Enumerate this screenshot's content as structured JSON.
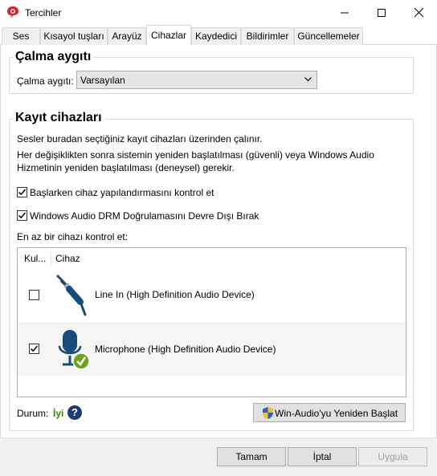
{
  "window": {
    "title": "Tercihler",
    "icons": {
      "app": "red-speech-bubble-icon",
      "minimize": "minimize-icon",
      "maximize": "maximize-icon",
      "close": "close-icon"
    }
  },
  "tabs": [
    {
      "label": "Ses",
      "active": false
    },
    {
      "label": "Kısayol tuşları",
      "active": false
    },
    {
      "label": "Arayüz",
      "active": false
    },
    {
      "label": "Cihazlar",
      "active": true
    },
    {
      "label": "Kaydedici",
      "active": false
    },
    {
      "label": "Bildirimler",
      "active": false
    },
    {
      "label": "Güncellemeler",
      "active": false
    }
  ],
  "playback": {
    "group_title": "Çalma aygıtı",
    "label": "Çalma aygıtı:",
    "selected": "Varsayılan"
  },
  "recording": {
    "group_title": "Kayıt cihazları",
    "info1": "Sesler buradan seçtiğiniz kayıt cihazları üzerinden çalınır.",
    "info2_line1": "Her değişiklikten sonra sistemin yeniden başlatılması (güvenli) veya Windows Audio",
    "info2_line2": "Hizmetinin yeniden başlatılması (deneysel) gerekir.",
    "check_startup": {
      "label": "Başlarken cihaz yapılandırmasını kontrol et",
      "checked": true
    },
    "check_drm": {
      "label": "Windows Audio DRM Doğrulamasını Devre Dışı Bırak",
      "checked": true
    },
    "list_label": "En az bir cihazı kontrol et:",
    "columns": [
      "Kul...",
      "Cihaz"
    ],
    "devices": [
      {
        "name": "Line In (High Definition Audio Device)",
        "checked": false,
        "icon": "line-in-jack-icon"
      },
      {
        "name": "Microphone (High Definition Audio Device)",
        "checked": true,
        "icon": "microphone-check-icon"
      }
    ],
    "status_label": "Durum:",
    "status_value": "İyi",
    "restart_button": "Win-Audio'yu Yeniden Başlat"
  },
  "footer": {
    "ok": "Tamam",
    "cancel": "İptal",
    "apply": "Uygula"
  },
  "colors": {
    "status_ok": "#2e8b00",
    "accent_blue": "#1e4f8c",
    "device_icon": "#1a4a7a",
    "check_green": "#6aa51f"
  }
}
